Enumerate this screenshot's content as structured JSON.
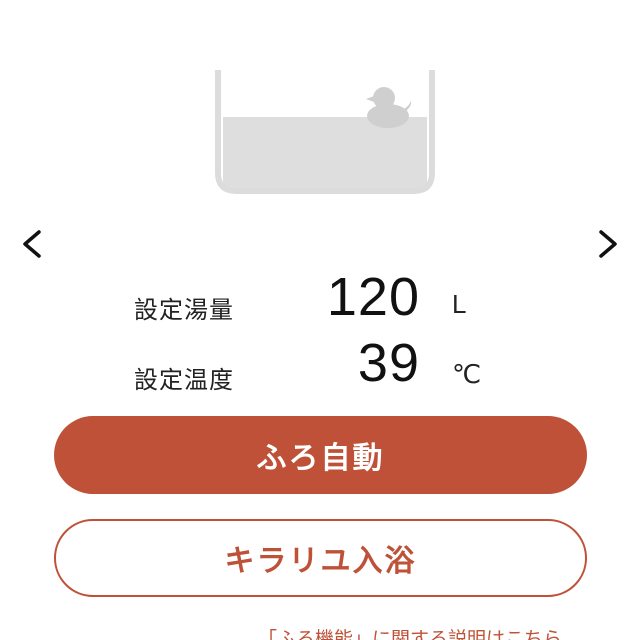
{
  "colors": {
    "accent": "#be5137",
    "tub_outline": "#dcdcdc",
    "water": "#dedede",
    "duck": "#cfcfcf"
  },
  "illustration": {
    "icon": "bathtub-with-duck-icon"
  },
  "nav": {
    "prev_icon": "chevron-left-icon",
    "next_icon": "chevron-right-icon"
  },
  "settings": {
    "amount": {
      "label": "設定湯量",
      "value": "120",
      "unit": "L"
    },
    "temperature": {
      "label": "設定温度",
      "value": "39",
      "unit": "℃"
    }
  },
  "buttons": {
    "auto_bath": "ふろ自動",
    "kirari_bath": "キラリユ入浴"
  },
  "help_link": "「ふろ機能」に関する説明はこちら"
}
